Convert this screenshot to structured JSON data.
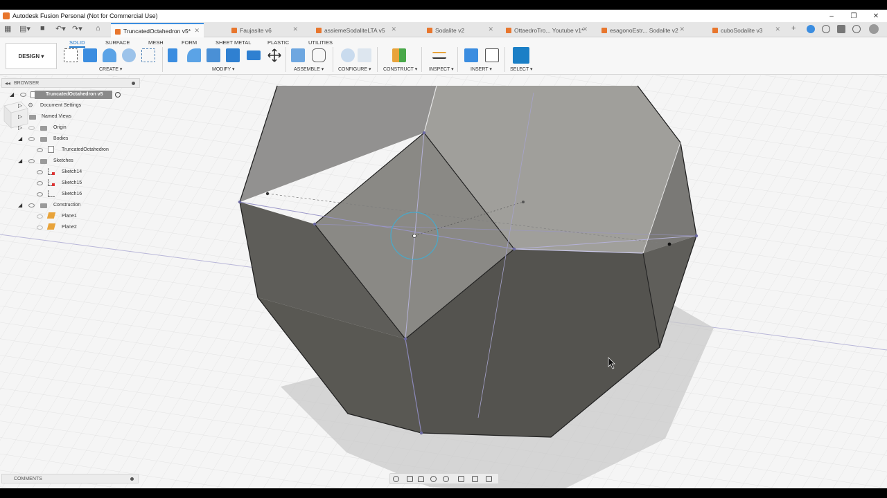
{
  "window": {
    "title": "Autodesk Fusion Personal (Not for Commercial Use)",
    "controls": [
      "–",
      "❐",
      "✕"
    ]
  },
  "tabs": [
    {
      "label": "TruncatedOctahedron v5*",
      "active": true
    },
    {
      "label": "Faujasite v6",
      "active": false
    },
    {
      "label": "assiemeSodaliteLTA v5",
      "active": false
    },
    {
      "label": "Sodalite v2",
      "active": false
    },
    {
      "label": "OttaedroTro... Youtube v1*",
      "active": false
    },
    {
      "label": "esagonoEstr... Sodalite v2",
      "active": false
    },
    {
      "label": "cuboSodalite v3",
      "active": false
    }
  ],
  "toolbar": {
    "workspace": "DESIGN",
    "workspace_tabs": [
      "SOLID",
      "SURFACE",
      "MESH",
      "FORM",
      "SHEET METAL",
      "PLASTIC",
      "UTILITIES"
    ],
    "groups": [
      "CREATE",
      "MODIFY",
      "ASSEMBLE",
      "CONFIGURE",
      "CONSTRUCT",
      "INSPECT",
      "INSERT",
      "SELECT"
    ]
  },
  "browser": {
    "header": "BROWSER",
    "root": "TruncatedOctahedron v5",
    "items": [
      {
        "label": "Document Settings"
      },
      {
        "label": "Named Views"
      },
      {
        "label": "Origin"
      },
      {
        "label": "Bodies"
      },
      {
        "label": "TruncatedOctahedron"
      },
      {
        "label": "Sketches"
      },
      {
        "label": "Sketch14"
      },
      {
        "label": "Sketch15"
      },
      {
        "label": "Sketch16"
      },
      {
        "label": "Construction"
      },
      {
        "label": "Plane1"
      },
      {
        "label": "Plane2"
      }
    ]
  },
  "comments": {
    "label": "COMMENTS"
  },
  "colors": {
    "accent": "#1a73c8",
    "body_dark": "#5b5a55",
    "body_light": "#8e8d88",
    "sketch_line": "#9a96c8",
    "highlight": "#4aa8c8"
  }
}
